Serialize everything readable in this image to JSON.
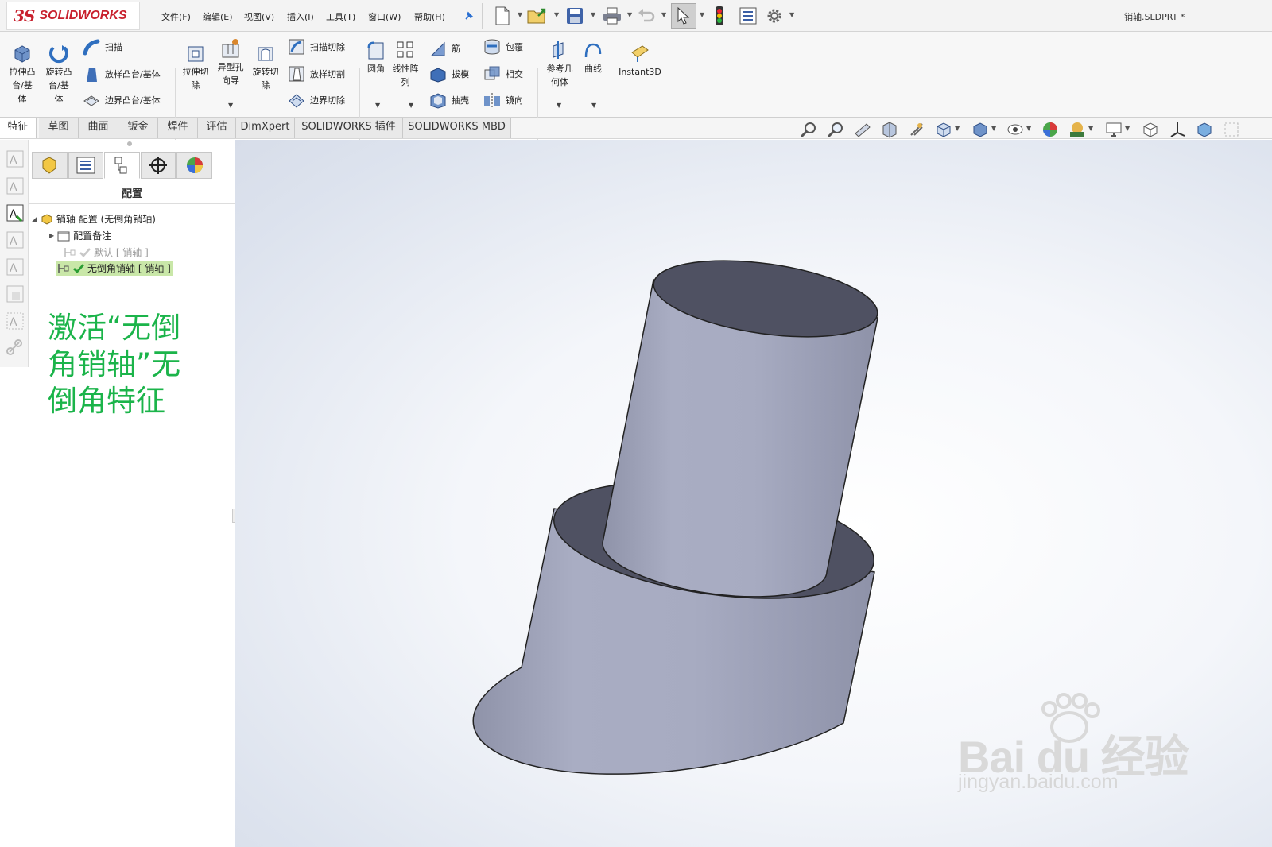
{
  "app": {
    "brand_ds": "3S",
    "brand_name": "SOLIDWORKS",
    "filename": "销轴.SLDPRT *"
  },
  "menu": [
    "文件(F)",
    "编辑(E)",
    "视图(V)",
    "插入(I)",
    "工具(T)",
    "窗口(W)",
    "帮助(H)"
  ],
  "ribbon": {
    "extrude_boss": [
      "拉伸凸",
      "台/基",
      "体"
    ],
    "revolve_boss": [
      "旋转凸",
      "台/基",
      "体"
    ],
    "sweep": "扫描",
    "loft_boss": "放样凸台/基体",
    "boundary_boss": "边界凸台/基体",
    "extrude_cut": [
      "拉伸切",
      "除"
    ],
    "hole_wizard": [
      "异型孔",
      "向导"
    ],
    "revolve_cut": [
      "旋转切",
      "除"
    ],
    "swept_cut": "扫描切除",
    "lofted_cut": "放样切割",
    "boundary_cut": "边界切除",
    "fillet": "圆角",
    "linear_pattern": [
      "线性阵",
      "列"
    ],
    "rib": "筋",
    "draft": "拔模",
    "shell": "抽壳",
    "wrap": "包覆",
    "intersect": "相交",
    "mirror": "镜向",
    "ref_geometry": [
      "参考几",
      "何体"
    ],
    "curves": "曲线",
    "instant3d": "Instant3D"
  },
  "tabs": [
    "特征",
    "草图",
    "曲面",
    "钣金",
    "焊件",
    "评估",
    "DimXpert",
    "SOLIDWORKS 插件",
    "SOLIDWORKS MBD"
  ],
  "panel": {
    "title": "配置",
    "root": "销轴 配置 (无倒角销轴)",
    "notes": "配置备注",
    "config_default": "默认 [ 销轴 ]",
    "config_active": "无倒角销轴 [ 销轴 ]"
  },
  "annotation": "激活“无倒角销轴”无倒角特征",
  "watermark": {
    "brand": "Bai du 经验",
    "url": "jingyan.baidu.com"
  },
  "colors": {
    "brand_red": "#c8202d",
    "annotation_green": "#1bb44a",
    "selection_green": "#c9e7a8",
    "model_face": "#a4a8c0",
    "model_top": "#4f5162"
  }
}
